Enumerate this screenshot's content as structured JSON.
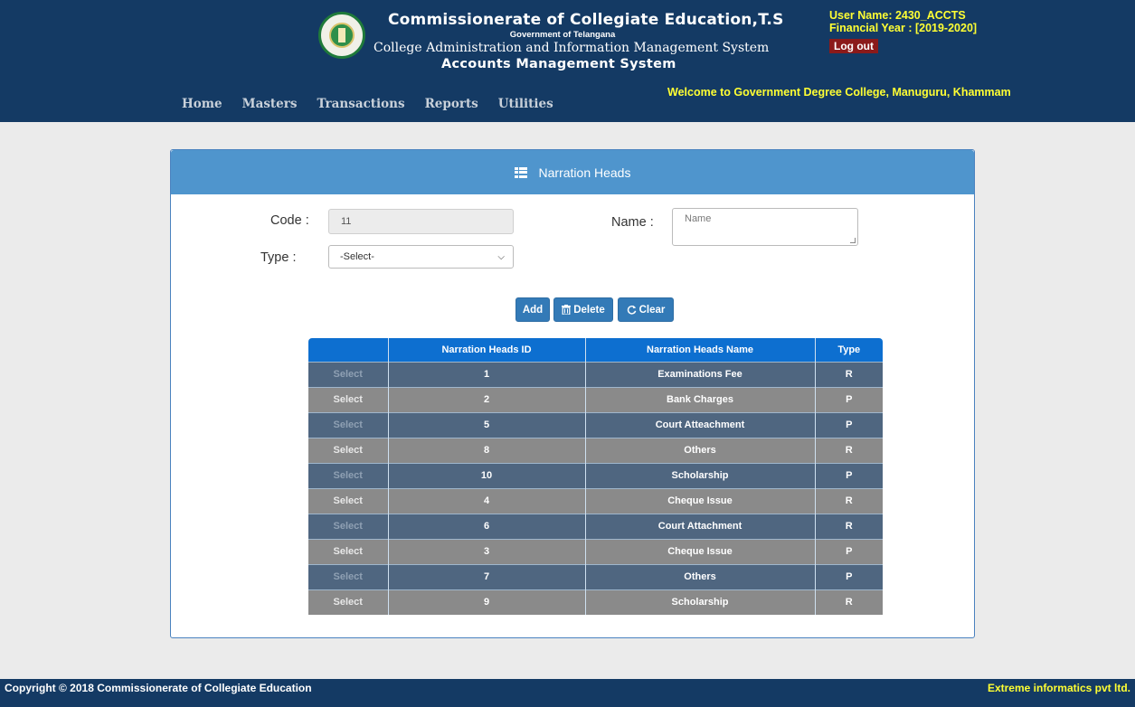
{
  "header": {
    "title": "Commissionerate of Collegiate Education,T.S",
    "subtitle": "Government of Telangana",
    "system": "College Administration and Information Management System",
    "module": "Accounts Management System"
  },
  "user": {
    "name": "User Name: 2430_ACCTS",
    "financial_year": "Financial Year : [2019-2020]",
    "logout_label": "Log out"
  },
  "nav": {
    "items": [
      {
        "label": "Home"
      },
      {
        "label": "Masters"
      },
      {
        "label": "Transactions"
      },
      {
        "label": "Reports"
      },
      {
        "label": "Utilities"
      }
    ]
  },
  "welcome": "Welcome to  Government Degree College, Manuguru, Khammam",
  "panel": {
    "title": "Narration Heads"
  },
  "form": {
    "code_label": "Code :",
    "code_value": "11",
    "name_label": "Name :",
    "name_placeholder": "Name",
    "type_label": "Type :",
    "type_selected": "-Select-"
  },
  "buttons": {
    "add": "Add",
    "delete": "Delete",
    "clear": "Clear"
  },
  "table": {
    "columns": [
      "",
      "Narration Heads ID",
      "Narration Heads Name",
      "Type"
    ],
    "rows": [
      {
        "select": "Select",
        "id": "1",
        "name": "Examinations Fee",
        "type": "R"
      },
      {
        "select": "Select",
        "id": "2",
        "name": "Bank Charges",
        "type": "P"
      },
      {
        "select": "Select",
        "id": "5",
        "name": "Court Atteachment",
        "type": "P"
      },
      {
        "select": "Select",
        "id": "8",
        "name": "Others",
        "type": "R"
      },
      {
        "select": "Select",
        "id": "10",
        "name": "Scholarship",
        "type": "P"
      },
      {
        "select": "Select",
        "id": "4",
        "name": "Cheque Issue",
        "type": "R"
      },
      {
        "select": "Select",
        "id": "6",
        "name": "Court Attachment",
        "type": "R"
      },
      {
        "select": "Select",
        "id": "3",
        "name": "Cheque Issue",
        "type": "P"
      },
      {
        "select": "Select",
        "id": "7",
        "name": "Others",
        "type": "P"
      },
      {
        "select": "Select",
        "id": "9",
        "name": "Scholarship",
        "type": "R"
      }
    ]
  },
  "footer": {
    "copyright": "Copyright © 2018 Commissionerate of Collegiate Education",
    "vendor": "Extreme informatics pvt ltd."
  },
  "colors": {
    "header_bg": "#143a64",
    "accent_yellow": "#ffff33",
    "panel_head": "#4f95cd",
    "table_head": "#0d6fd0",
    "row_dark": "#4f6680",
    "row_light": "#8a8a8a",
    "button": "#337ab7"
  },
  "icons": {
    "panel": "list-icon",
    "delete": "trash-icon",
    "clear": "refresh-icon",
    "logo": "telangana-emblem"
  }
}
